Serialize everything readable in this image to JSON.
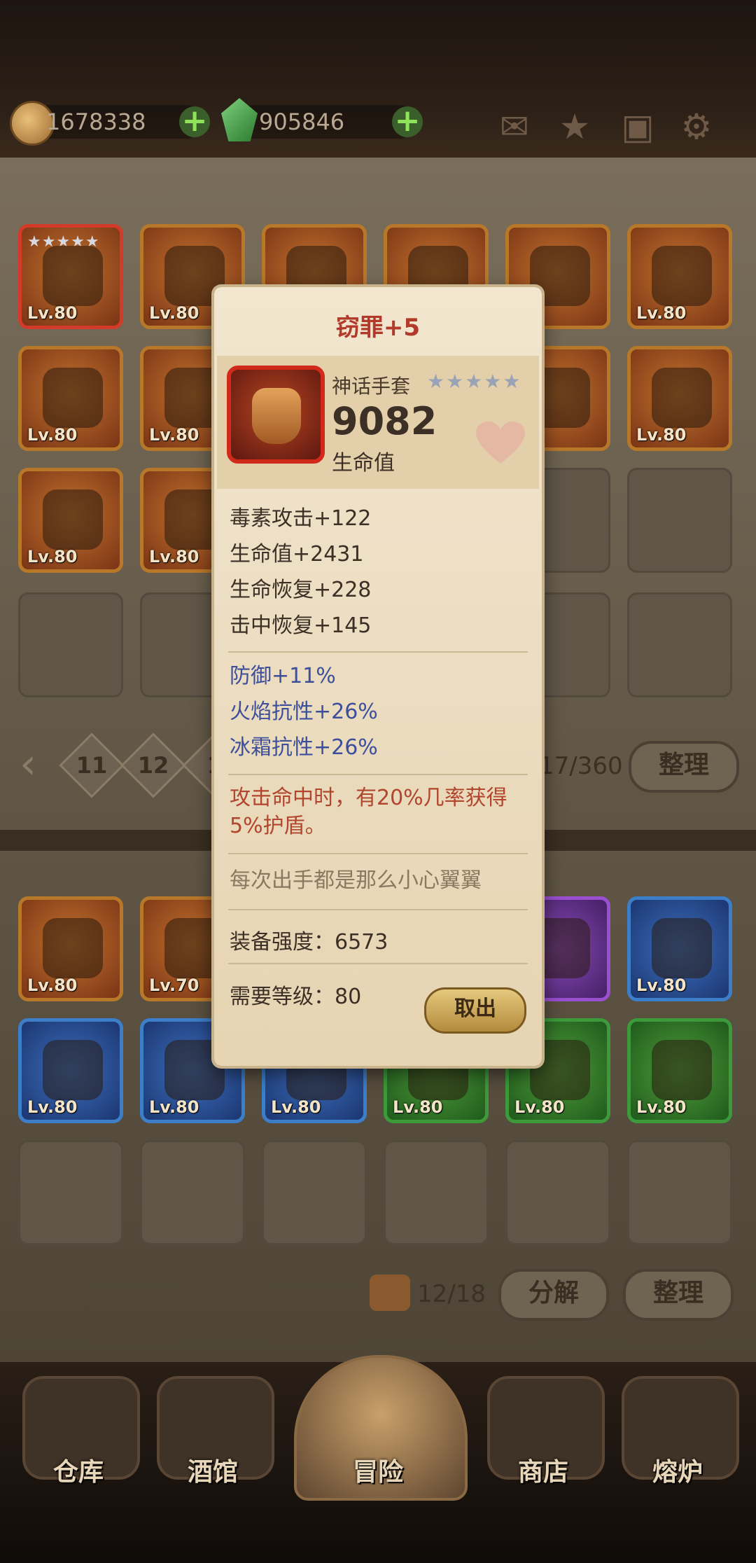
{
  "resources": {
    "gold": "1678338",
    "gems": "905846"
  },
  "top_icons": [
    "mail-icon",
    "favorite-icon",
    "storage-icon",
    "gear-icon"
  ],
  "upper_slots": [
    {
      "level": "Lv.80",
      "stars": "★★★★★"
    },
    {
      "level": "Lv.80"
    },
    {
      "level": ""
    },
    {
      "level": ""
    },
    {
      "level": "80"
    },
    {
      "level": "Lv.80"
    },
    {
      "level": "Lv.80"
    },
    {
      "level": "Lv.80"
    },
    {
      "level": "80"
    },
    {
      "level": "Lv.80"
    },
    {
      "level": "Lv.80"
    },
    {
      "level": "Lv.80"
    }
  ],
  "pagination": {
    "pages": [
      "11",
      "12",
      "1"
    ],
    "count": "17/360",
    "sort_label": "整理"
  },
  "lower_slots": [
    {
      "level": "Lv.80"
    },
    {
      "level": "Lv.70"
    },
    {
      "level": "80"
    },
    {
      "level": "Lv.80"
    },
    {
      "level": "Lv.80"
    },
    {
      "level": "Lv.80"
    },
    {
      "level": "Lv.80"
    },
    {
      "level": "Lv.80"
    },
    {
      "level": "Lv.80"
    },
    {
      "level": "Lv.80"
    }
  ],
  "lower_bar": {
    "count": "12/18",
    "salvage_label": "分解",
    "sort_label": "整理"
  },
  "tabs": [
    "仓库",
    "酒馆",
    "冒险",
    "商店",
    "熔炉"
  ],
  "popup": {
    "title": "窃罪+5",
    "item_type": "神话手套",
    "stars": "★★★★★",
    "main_value": "9082",
    "main_stat": "生命值",
    "base_stats": [
      "毒素攻击+122",
      "生命值+2431",
      "生命恢复+228",
      "击中恢复+145"
    ],
    "bonus_stats": [
      "防御+11%",
      "火焰抗性+26%",
      "冰霜抗性+26%"
    ],
    "effect": "攻击命中时，有20%几率获得5%护盾。",
    "flavor": "每次出手都是那么小心翼翼",
    "power": "装备强度：6573",
    "required_level": "需要等级：80",
    "take_label": "取出"
  }
}
